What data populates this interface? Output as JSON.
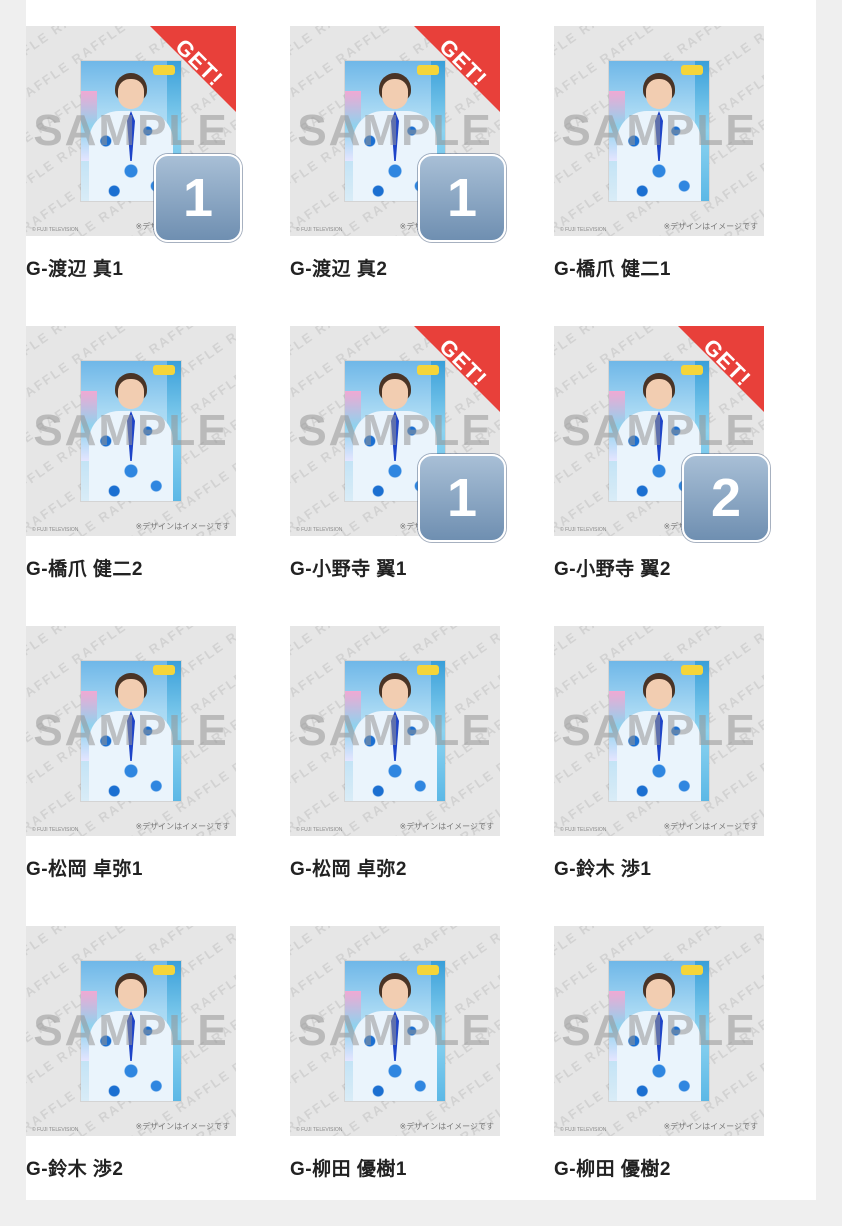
{
  "watermark": {
    "sample_text": "SAMPLE",
    "raffle_text": "RAFFLE RAFFLE RAFFLE RAFFLE RAFFLE",
    "copyright": "© FUJI TELEVISION",
    "disclaimer": "※デザインはイメージです"
  },
  "ribbon": {
    "get_label": "GET!"
  },
  "items": [
    {
      "name": "G-渡辺 真1",
      "get": true,
      "count": "1"
    },
    {
      "name": "G-渡辺 真2",
      "get": true,
      "count": "1"
    },
    {
      "name": "G-橋爪 健二1",
      "get": false,
      "count": ""
    },
    {
      "name": "G-橋爪 健二2",
      "get": false,
      "count": ""
    },
    {
      "name": "G-小野寺 翼1",
      "get": true,
      "count": "1"
    },
    {
      "name": "G-小野寺 翼2",
      "get": true,
      "count": "2"
    },
    {
      "name": "G-松岡 卓弥1",
      "get": false,
      "count": ""
    },
    {
      "name": "G-松岡 卓弥2",
      "get": false,
      "count": ""
    },
    {
      "name": "G-鈴木 渉1",
      "get": false,
      "count": ""
    },
    {
      "name": "G-鈴木 渉2",
      "get": false,
      "count": ""
    },
    {
      "name": "G-柳田 優樹1",
      "get": false,
      "count": ""
    },
    {
      "name": "G-柳田 優樹2",
      "get": false,
      "count": ""
    }
  ]
}
